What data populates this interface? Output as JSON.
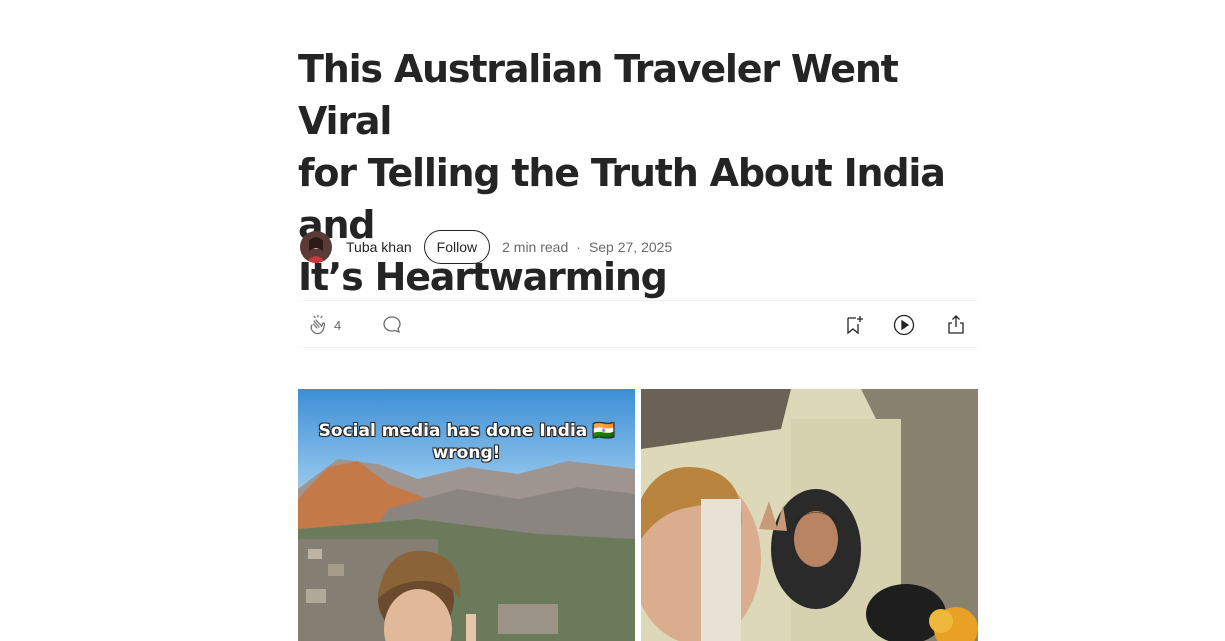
{
  "article": {
    "title_lines": [
      "This Australian Traveler Went Viral",
      "for Telling the Truth About India and",
      "It’s Heartwarming"
    ]
  },
  "byline": {
    "author": "Tuba khan",
    "follow_label": "Follow",
    "read_time": "2 min read",
    "separator": "·",
    "date": "Sep 27, 2025"
  },
  "actions": {
    "clap_count": "4",
    "icons": [
      "clap-icon",
      "comment-icon",
      "bookmark-add-icon",
      "listen-play-icon",
      "share-icon"
    ]
  },
  "images": {
    "left_overlay_line1": "Social media has done India 🇮🇳",
    "left_overlay_line2": "wrong!"
  },
  "colors": {
    "text": "#242424",
    "muted": "#6b6b6b",
    "divider": "#f2f2f2"
  }
}
